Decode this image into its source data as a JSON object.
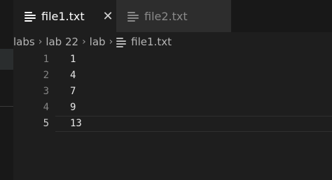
{
  "tabs": [
    {
      "label": "file1.txt",
      "icon": "lines-icon",
      "active": true,
      "close_glyph": "✕"
    },
    {
      "label": "file2.txt",
      "icon": "lines-icon",
      "active": false
    }
  ],
  "breadcrumb": [
    "labs",
    "lab 22",
    "lab",
    "file1.txt"
  ],
  "breadcrumb_separator": "›",
  "editor": {
    "lines": [
      {
        "number": "1",
        "text": "1"
      },
      {
        "number": "2",
        "text": "4"
      },
      {
        "number": "3",
        "text": "7"
      },
      {
        "number": "4",
        "text": "9"
      },
      {
        "number": "5",
        "text": "13"
      }
    ],
    "current_line": 5
  }
}
